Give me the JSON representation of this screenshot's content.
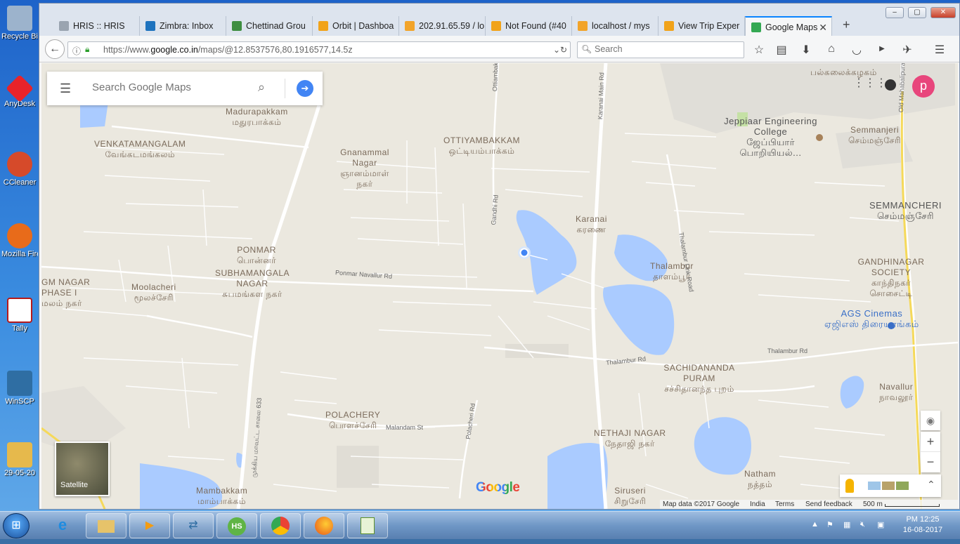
{
  "desktop": {
    "icons": [
      {
        "label": "Recycle Bin",
        "color": "#9cb3cc"
      },
      {
        "label": "AnyDesk",
        "color": "#e8232a"
      },
      {
        "label": "CCleaner",
        "color": "#d64a2a"
      },
      {
        "label": "Mozilla Firefox",
        "color": "#e86b1a"
      },
      {
        "label": "Tally",
        "color": "#b5191a"
      },
      {
        "label": "WinSCP",
        "color": "#2f6ea3"
      },
      {
        "label": "29-05-20",
        "color": "#e6b94c"
      }
    ]
  },
  "browser": {
    "tabs": [
      {
        "title": "HRIS :: HRIS",
        "icon_color": "#9aa4b0"
      },
      {
        "title": "Zimbra: Inbox",
        "icon_color": "#1e73be"
      },
      {
        "title": "Chettinad Grou",
        "icon_color": "#3e8e41"
      },
      {
        "title": "Orbit | Dashboa",
        "icon_color": "#f1a31a"
      },
      {
        "title": "202.91.65.59 / lo",
        "icon_color": "#f2a42a"
      },
      {
        "title": "Not Found (#40",
        "icon_color": "#f1a31a"
      },
      {
        "title": "localhost / mys",
        "icon_color": "#f2a42a"
      },
      {
        "title": "View Trip Exper",
        "icon_color": "#f1a31a"
      },
      {
        "title": "Google Maps",
        "icon_color": "#34a853"
      }
    ],
    "active_tab": "Google Maps",
    "url_prefix": "https://www.",
    "url_domain": "google.co.in",
    "url_path": "/maps/@12.8537576,80.1916577,14.5z",
    "search_placeholder": "Search"
  },
  "map": {
    "search_placeholder": "Search Google Maps",
    "avatar_letter": "p",
    "satellite_label": "Satellite",
    "google_logo": "Google",
    "footer": {
      "map_data": "Map data ©2017 Google",
      "region": "India",
      "terms": "Terms",
      "feedback": "Send feedback",
      "scale": "500 m"
    },
    "places": [
      {
        "en": "Madurapakkam",
        "ta": "மதுரபாக்கம்"
      },
      {
        "en": "VENKATAMANGALAM",
        "ta": "வேங்கடமங்கலம்"
      },
      {
        "en": "Gnanammal Nagar",
        "ta": "ஞானம்மாள் நகர்"
      },
      {
        "en": "OTTIYAMBAKKAM",
        "ta": "ஒட்டியம்பாக்கம்"
      },
      {
        "en": "Karanai",
        "ta": "கரணை"
      },
      {
        "en": "Jeppiaar Engineering College",
        "ta": "ஜேப்பியார் பொறியியல்..."
      },
      {
        "en": "Semmanjeri",
        "ta": "செம்மஞ்சேரி"
      },
      {
        "en": "SEMMANCHERI",
        "ta": "செம்மஞ்சேரி"
      },
      {
        "en": "PONMAR",
        "ta": "பொன்னர்"
      },
      {
        "en": "SUBHAMANGALA NAGAR",
        "ta": "சுபமங்கள நகர்"
      },
      {
        "en": "Moolacheri",
        "ta": "மூலச்சேரி"
      },
      {
        "en": "Thalambur",
        "ta": "தாளம்பூர்"
      },
      {
        "en": "GANDHINAGAR SOCIETY",
        "ta": "காந்திநகர் சொசைட்டி"
      },
      {
        "en": "AGS Cinemas",
        "ta": "ஏஜிஎஸ் திரையரங்கம்"
      },
      {
        "en": "SACHIDANANDA PURAM",
        "ta": "சச்சிதானந்த புறம்"
      },
      {
        "en": "Navallur",
        "ta": "நாவலூர்"
      },
      {
        "en": "POLACHERY",
        "ta": "பொளச்சேரி"
      },
      {
        "en": "NETHAJI NAGAR",
        "ta": "நேதாஜி நகர்"
      },
      {
        "en": "Natham",
        "ta": "நத்தம்"
      },
      {
        "en": "Mambakkam",
        "ta": "மாம்பாக்கம்"
      },
      {
        "en": "Siruseri",
        "ta": "சிறுசேரி"
      },
      {
        "en": "GM NAGAR PHASE I",
        "ta": "மலம் நகர்"
      },
      {
        "en": "",
        "ta": "பல்கலைக்கழகம்"
      }
    ],
    "roads": [
      "Ottiambakkam Main Rd",
      "Karanai Main Rd",
      "Gandhi Rd",
      "Thalambur Link Road",
      "Old Mahabalipuram Rd",
      "Ponmar Navallur Rd",
      "Thalambur Rd",
      "Thalambur Rd",
      "Polacheri Rd",
      "Malandam St",
      "முக்கிய மாவட்ட சாலை 633"
    ]
  },
  "taskbar": {
    "time": "PM 12:25",
    "date": "16-08-2017"
  }
}
